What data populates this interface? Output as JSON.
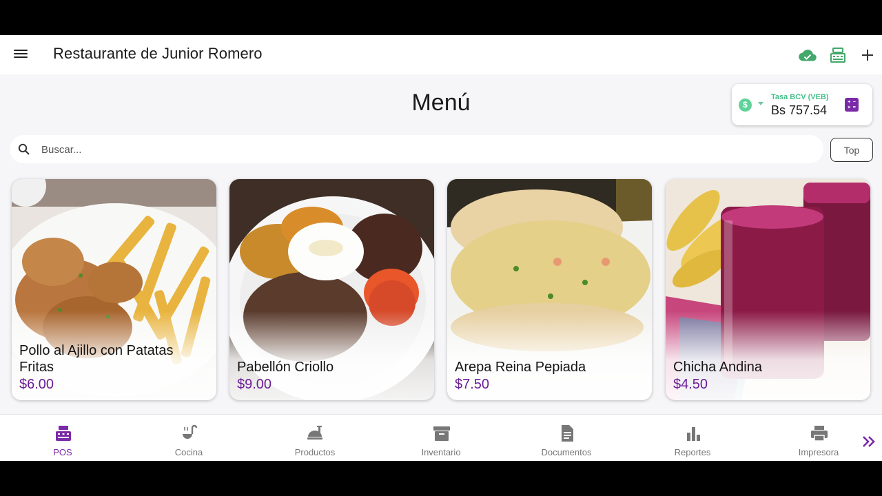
{
  "app": {
    "title": "Restaurante de Junior Romero"
  },
  "appbar": {
    "menu_icon": "hamburger-menu-icon",
    "actions": [
      "cloud-check-icon",
      "cash-register-icon",
      "plus-icon"
    ]
  },
  "heading": "Menú",
  "rate": {
    "label": "Tasa BCV (VEB)",
    "value": "Bs 757.54",
    "currency_icon": "dollar-circle-icon",
    "calculator_icon": "calculator-icon"
  },
  "search": {
    "placeholder": "Buscar...",
    "value": ""
  },
  "top_button": "Top",
  "products": [
    {
      "name": "Pollo al Ajillo con Patatas Fritas",
      "price": "$6.00"
    },
    {
      "name": "Pabellón Criollo",
      "price": "$9.00"
    },
    {
      "name": "Arepa Reina Pepiada",
      "price": "$7.50"
    },
    {
      "name": "Chicha Andina",
      "price": "$4.50"
    }
  ],
  "nav": {
    "items": [
      {
        "label": "POS",
        "icon": "cash-register-icon",
        "active": true
      },
      {
        "label": "Cocina",
        "icon": "ladle-icon",
        "active": false
      },
      {
        "label": "Productos",
        "icon": "food-icon",
        "active": false
      },
      {
        "label": "Inventario",
        "icon": "archive-box-icon",
        "active": false
      },
      {
        "label": "Documentos",
        "icon": "document-icon",
        "active": false
      },
      {
        "label": "Reportes",
        "icon": "bar-chart-icon",
        "active": false
      },
      {
        "label": "Impresora",
        "icon": "printer-icon",
        "active": false
      }
    ],
    "more_icon": "double-chevron-right-icon"
  },
  "colors": {
    "accent": "#7b2aa8",
    "success": "#45c08a",
    "price": "#6a1d96"
  }
}
